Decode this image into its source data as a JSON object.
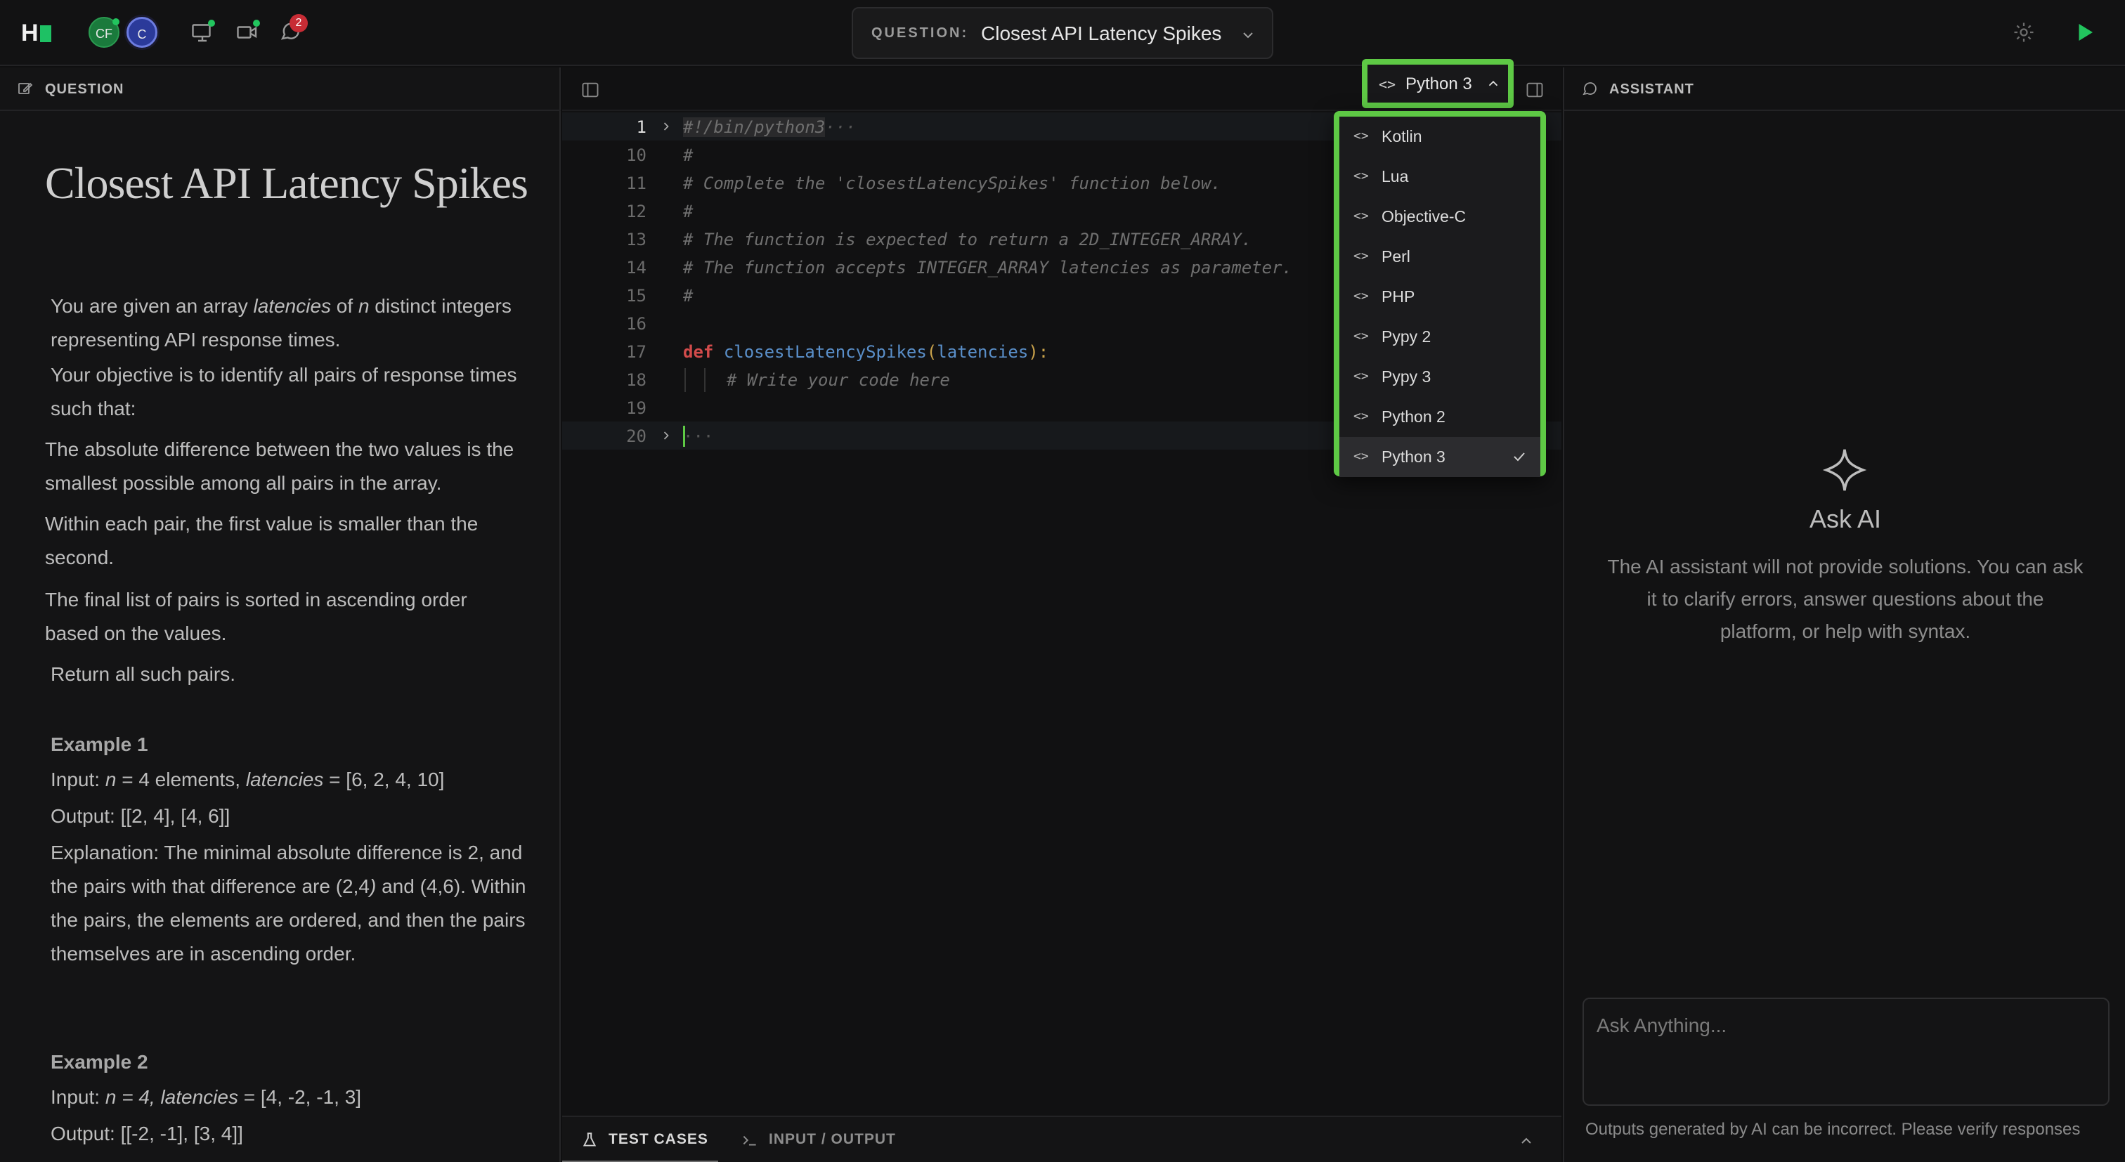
{
  "topbar": {
    "logo_text": "H",
    "avatars": [
      "CF",
      "C"
    ],
    "notification_count": "2",
    "question_label": "QUESTION:",
    "question_title": "Closest API Latency Spikes"
  },
  "left_panel": {
    "header": "QUESTION",
    "title": "Closest API Latency Spikes",
    "intro_1a": "You are given an array ",
    "intro_1b": "latencies",
    "intro_1c": " of ",
    "intro_1d": "n",
    "intro_1e": " distinct integers representing API response times.",
    "intro_2": "Your objective is to identify all pairs of response times such that:",
    "rule_1": "The absolute difference between the two values is the smallest possible among all pairs in the array.",
    "rule_2": "Within each pair, the first value is smaller than the second.",
    "rule_3": "The final list of pairs is sorted in ascending order based on the values.",
    "return_text": "Return all such pairs.",
    "example1": {
      "heading": "Example 1",
      "input_a": "Input: ",
      "input_b": "n",
      "input_c": " = 4 elements, ",
      "input_d": "latencies",
      "input_e": " = [6, 2, 4, 10]",
      "output": "Output: [[2, 4], [4, 6]]",
      "explanation_a": "Explanation: The minimal absolute difference is 2, and the pairs with that difference are (2,4",
      "explanation_b": ")",
      "explanation_c": " and (4,6). Within the pairs, the elements are ordered, and then the pairs themselves are in ascending order."
    },
    "example2": {
      "heading": "Example 2",
      "input_a": "Input: ",
      "input_b": "n = 4, latencies",
      "input_c": " = [4, -2, -1, 3]",
      "output": "Output: [[-2, -1], [3, 4]]"
    }
  },
  "editor": {
    "language": "Python 3",
    "lines": [
      {
        "n": "1",
        "text": "#!/bin/python3",
        "suffix": "···"
      },
      {
        "n": "10",
        "text": "#"
      },
      {
        "n": "11",
        "text": "# Complete the 'closestLatencySpikes' function below."
      },
      {
        "n": "12",
        "text": "#"
      },
      {
        "n": "13",
        "text": "# The function is expected to return a 2D_INTEGER_ARRAY."
      },
      {
        "n": "14",
        "text": "# The function accepts INTEGER_ARRAY latencies as parameter."
      },
      {
        "n": "15",
        "text": "#"
      },
      {
        "n": "16",
        "text": ""
      },
      {
        "n": "17",
        "kw": "def",
        "fn": "closestLatencySpikes",
        "param": "latencies",
        "colon": ":"
      },
      {
        "n": "18",
        "text": "# Write your code here"
      },
      {
        "n": "19",
        "text": ""
      },
      {
        "n": "20",
        "text": "···"
      }
    ],
    "dropdown": [
      {
        "label": "Kotlin",
        "selected": false
      },
      {
        "label": "Lua",
        "selected": false
      },
      {
        "label": "Objective-C",
        "selected": false
      },
      {
        "label": "Perl",
        "selected": false
      },
      {
        "label": "PHP",
        "selected": false
      },
      {
        "label": "Pypy 2",
        "selected": false
      },
      {
        "label": "Pypy 3",
        "selected": false
      },
      {
        "label": "Python 2",
        "selected": false
      },
      {
        "label": "Python 3",
        "selected": true
      }
    ],
    "code_glyph": "<>",
    "tabs": {
      "test_cases": "TEST CASES",
      "input_output": "INPUT / OUTPUT"
    }
  },
  "assistant": {
    "header": "ASSISTANT",
    "title": "Ask AI",
    "description": "The AI assistant will not provide solutions. You can ask it to clarify errors, answer questions about the platform, or help with syntax.",
    "input_placeholder": "Ask Anything...",
    "disclaimer": "Outputs generated by AI can be incorrect. Please verify responses"
  },
  "colors": {
    "highlight": "#5ec945",
    "badge": "#c72c35",
    "run": "#22c55e"
  }
}
